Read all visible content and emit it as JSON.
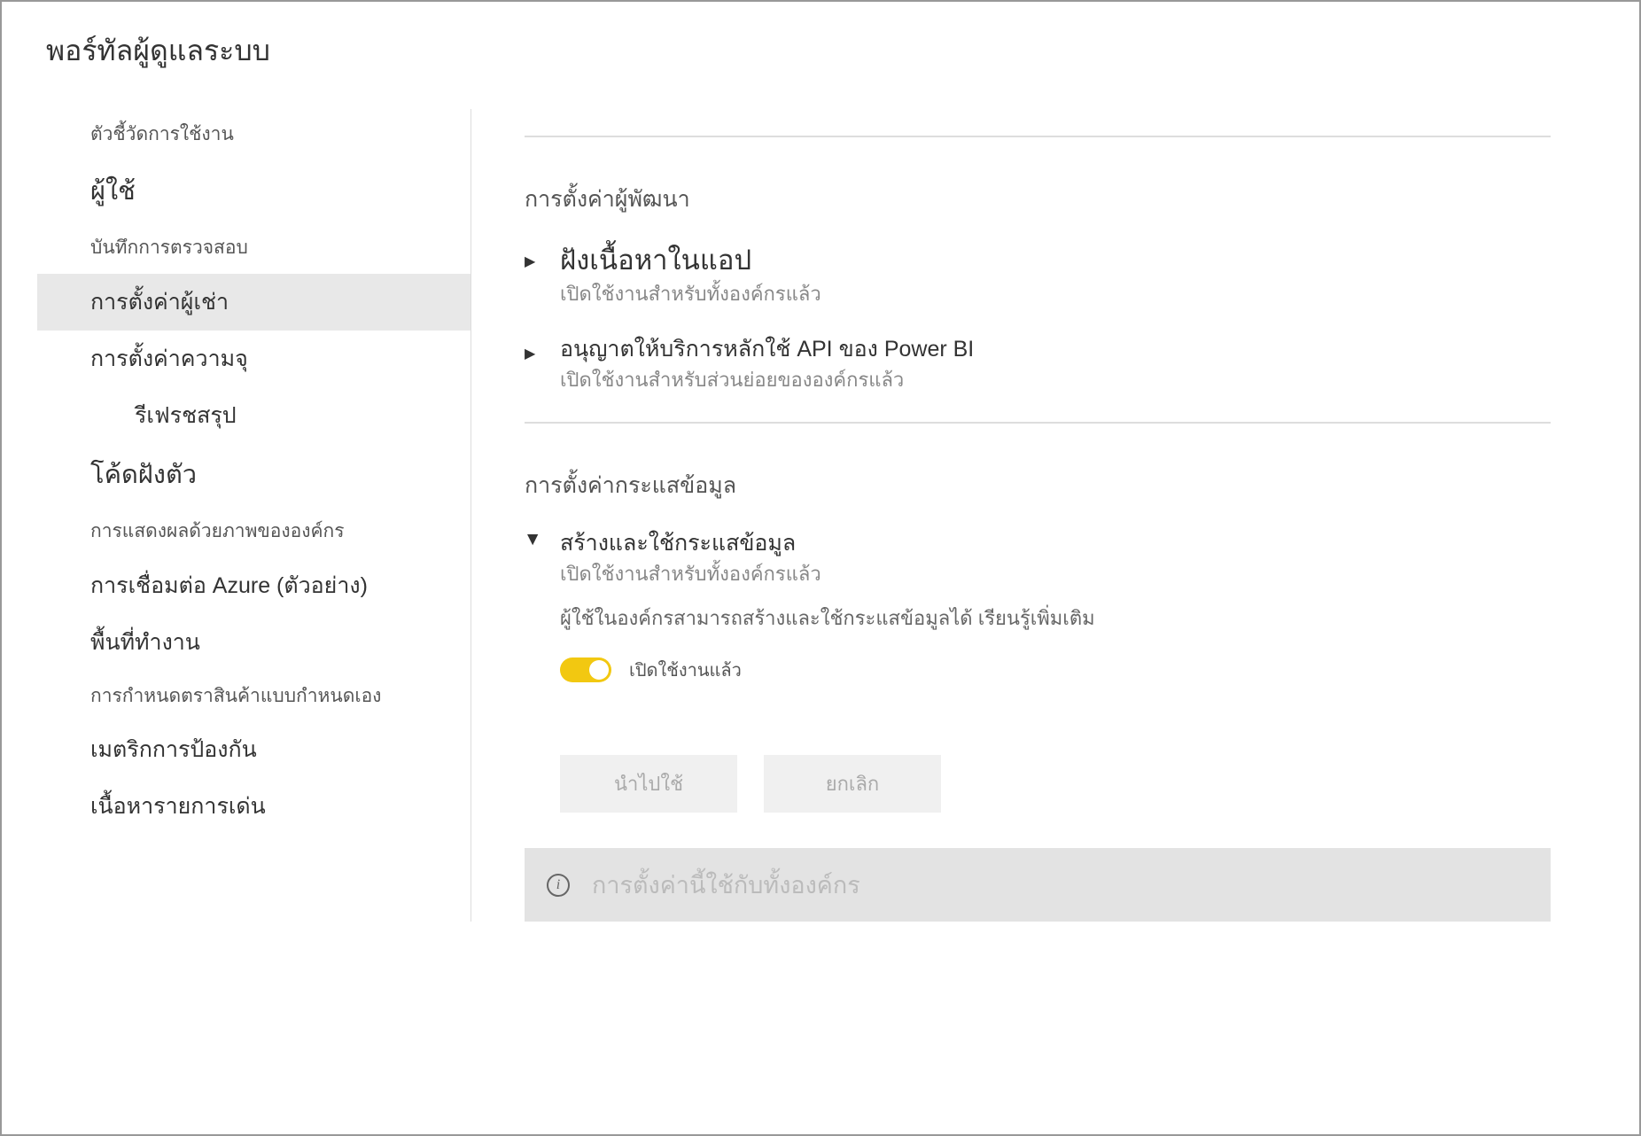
{
  "header": {
    "title": "พอร์ทัลผู้ดูแลระบบ"
  },
  "sidebar": {
    "items": [
      {
        "label": "ตัวชี้วัดการใช้งาน",
        "size": "small"
      },
      {
        "label": "ผู้ใช้",
        "size": "large"
      },
      {
        "label": "บันทึกการตรวจสอบ",
        "size": "small"
      },
      {
        "label": "การตั้งค่าผู้เช่า",
        "size": "medium",
        "active": true
      },
      {
        "label": "การตั้งค่าความจุ",
        "size": "medium"
      },
      {
        "label": "รีเฟรชสรุป",
        "size": "medium",
        "indent": true
      },
      {
        "label": "โค้ดฝังตัว",
        "size": "large"
      },
      {
        "label": "การแสดงผลด้วยภาพขององค์กร",
        "size": "small"
      },
      {
        "label": "การเชื่อมต่อ Azure (ตัวอย่าง)",
        "size": "medium"
      },
      {
        "label": "พื้นที่ทำงาน",
        "size": "medium"
      },
      {
        "label": "การกำหนดตราสินค้าแบบกำหนดเอง",
        "size": "small"
      },
      {
        "label": "เมตริกการป้องกัน",
        "size": "medium"
      },
      {
        "label": "เนื้อหารายการเด่น",
        "size": "medium"
      }
    ]
  },
  "content": {
    "section1": {
      "heading": "การตั้งค่าผู้พัฒนา",
      "item1": {
        "title": "ฝังเนื้อหาในแอป",
        "subtitle": "เปิดใช้งานสำหรับทั้งองค์กรแล้ว"
      },
      "item2": {
        "title": "อนุญาตให้บริการหลักใช้ API ของ Power BI",
        "subtitle": "เปิดใช้งานสำหรับส่วนย่อยขององค์กรแล้ว"
      }
    },
    "section2": {
      "heading": "การตั้งค่ากระแสข้อมูล",
      "item1": {
        "title": "สร้างและใช้กระแสข้อมูล",
        "subtitle": "เปิดใช้งานสำหรับทั้งองค์กรแล้ว",
        "description": "ผู้ใช้ในองค์กรสามารถสร้างและใช้กระแสข้อมูลได้",
        "learnMore": "เรียนรู้เพิ่มเติม",
        "toggleLabel": "เปิดใช้งานแล้ว"
      }
    },
    "buttons": {
      "apply": "นำไปใช้",
      "cancel": "ยกเลิก"
    },
    "infoBanner": "การตั้งค่านี้ใช้กับทั้งองค์กร"
  }
}
